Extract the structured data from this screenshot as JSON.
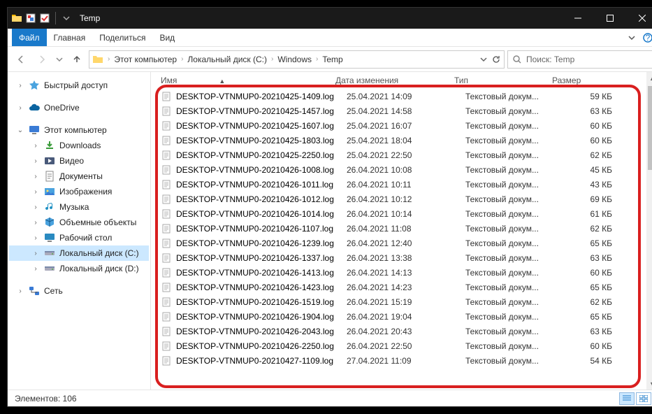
{
  "window": {
    "title": "Temp"
  },
  "menubar": {
    "file": "Файл",
    "home": "Главная",
    "share": "Поделиться",
    "view": "Вид"
  },
  "breadcrumb": {
    "items": [
      "Этот компьютер",
      "Локальный диск (C:)",
      "Windows",
      "Temp"
    ]
  },
  "search": {
    "placeholder": "Поиск: Temp"
  },
  "nav": {
    "quick_access": "Быстрый доступ",
    "onedrive": "OneDrive",
    "this_pc": "Этот компьютер",
    "downloads": "Downloads",
    "videos": "Видео",
    "documents": "Документы",
    "pictures": "Изображения",
    "music": "Музыка",
    "objects3d": "Объемные объекты",
    "desktop": "Рабочий стол",
    "disk_c": "Локальный диск (C:)",
    "disk_d": "Локальный диск (D:)",
    "network": "Сеть"
  },
  "columns": {
    "name": "Имя",
    "date": "Дата изменения",
    "type": "Тип",
    "size": "Размер"
  },
  "files": [
    {
      "name": "DESKTOP-VTNMUP0-20210425-1409.log",
      "date": "25.04.2021 14:09",
      "type": "Текстовый докум...",
      "size": "59 КБ"
    },
    {
      "name": "DESKTOP-VTNMUP0-20210425-1457.log",
      "date": "25.04.2021 14:58",
      "type": "Текстовый докум...",
      "size": "63 КБ"
    },
    {
      "name": "DESKTOP-VTNMUP0-20210425-1607.log",
      "date": "25.04.2021 16:07",
      "type": "Текстовый докум...",
      "size": "60 КБ"
    },
    {
      "name": "DESKTOP-VTNMUP0-20210425-1803.log",
      "date": "25.04.2021 18:04",
      "type": "Текстовый докум...",
      "size": "60 КБ"
    },
    {
      "name": "DESKTOP-VTNMUP0-20210425-2250.log",
      "date": "25.04.2021 22:50",
      "type": "Текстовый докум...",
      "size": "62 КБ"
    },
    {
      "name": "DESKTOP-VTNMUP0-20210426-1008.log",
      "date": "26.04.2021 10:08",
      "type": "Текстовый докум...",
      "size": "45 КБ"
    },
    {
      "name": "DESKTOP-VTNMUP0-20210426-1011.log",
      "date": "26.04.2021 10:11",
      "type": "Текстовый докум...",
      "size": "43 КБ"
    },
    {
      "name": "DESKTOP-VTNMUP0-20210426-1012.log",
      "date": "26.04.2021 10:12",
      "type": "Текстовый докум...",
      "size": "69 КБ"
    },
    {
      "name": "DESKTOP-VTNMUP0-20210426-1014.log",
      "date": "26.04.2021 10:14",
      "type": "Текстовый докум...",
      "size": "61 КБ"
    },
    {
      "name": "DESKTOP-VTNMUP0-20210426-1107.log",
      "date": "26.04.2021 11:08",
      "type": "Текстовый докум...",
      "size": "62 КБ"
    },
    {
      "name": "DESKTOP-VTNMUP0-20210426-1239.log",
      "date": "26.04.2021 12:40",
      "type": "Текстовый докум...",
      "size": "65 КБ"
    },
    {
      "name": "DESKTOP-VTNMUP0-20210426-1337.log",
      "date": "26.04.2021 13:38",
      "type": "Текстовый докум...",
      "size": "63 КБ"
    },
    {
      "name": "DESKTOP-VTNMUP0-20210426-1413.log",
      "date": "26.04.2021 14:13",
      "type": "Текстовый докум...",
      "size": "60 КБ"
    },
    {
      "name": "DESKTOP-VTNMUP0-20210426-1423.log",
      "date": "26.04.2021 14:23",
      "type": "Текстовый докум...",
      "size": "65 КБ"
    },
    {
      "name": "DESKTOP-VTNMUP0-20210426-1519.log",
      "date": "26.04.2021 15:19",
      "type": "Текстовый докум...",
      "size": "62 КБ"
    },
    {
      "name": "DESKTOP-VTNMUP0-20210426-1904.log",
      "date": "26.04.2021 19:04",
      "type": "Текстовый докум...",
      "size": "65 КБ"
    },
    {
      "name": "DESKTOP-VTNMUP0-20210426-2043.log",
      "date": "26.04.2021 20:43",
      "type": "Текстовый докум...",
      "size": "63 КБ"
    },
    {
      "name": "DESKTOP-VTNMUP0-20210426-2250.log",
      "date": "26.04.2021 22:50",
      "type": "Текстовый докум...",
      "size": "60 КБ"
    },
    {
      "name": "DESKTOP-VTNMUP0-20210427-1109.log",
      "date": "27.04.2021 11:09",
      "type": "Текстовый докум...",
      "size": "54 КБ"
    }
  ],
  "status": {
    "items": "Элементов: 106"
  }
}
